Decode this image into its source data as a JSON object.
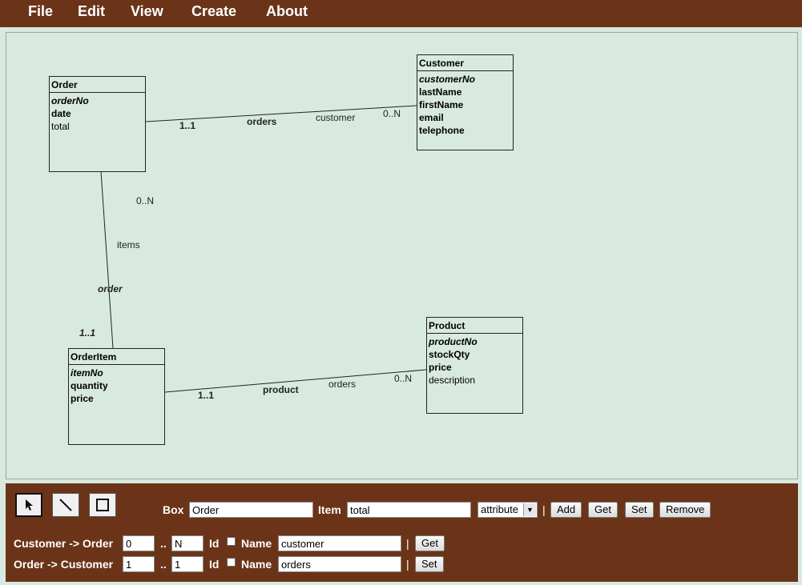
{
  "menu": {
    "file": "File",
    "edit": "Edit",
    "view": "View",
    "create": "Create",
    "about": "About"
  },
  "diagram": {
    "order": {
      "title": "Order",
      "attrs": [
        "orderNo",
        "date",
        "total"
      ]
    },
    "customer": {
      "title": "Customer",
      "attrs": [
        "customerNo",
        "lastName",
        "firstName",
        "email",
        "telephone"
      ]
    },
    "orderitem": {
      "title": "OrderItem",
      "attrs": [
        "itemNo",
        "quantity",
        "price"
      ]
    },
    "product": {
      "title": "Product",
      "attrs": [
        "productNo",
        "stockQty",
        "price",
        "description"
      ]
    },
    "labels": {
      "oc_mult_order": "1..1",
      "oc_role_order": "orders",
      "oc_role_customer": "customer",
      "oc_mult_customer": "0..N",
      "oi_mult_order": "0..N",
      "oi_role_order": "items",
      "oi_role_item": "order",
      "oi_mult_item": "1..1",
      "ip_mult_item": "1..1",
      "ip_role_item": "product",
      "ip_role_product": "orders",
      "ip_mult_product": "0..N"
    }
  },
  "toolbar": {
    "box_label": "Box",
    "box_value": "Order",
    "item_label": "Item",
    "item_value": "total",
    "item_type": "attribute",
    "sep": "|",
    "add": "Add",
    "get": "Get",
    "set": "Set",
    "remove": "Remove",
    "rel1": {
      "label": "Customer -> Order",
      "min": "0",
      "dots": "..",
      "max": "N",
      "id_label": "Id",
      "name_label": "Name",
      "name": "customer",
      "button": "Get"
    },
    "rel2": {
      "label": "Order -> Customer",
      "min": "1",
      "dots": "..",
      "max": "1",
      "id_label": "Id",
      "name_label": "Name",
      "name": "orders",
      "button": "Set"
    }
  }
}
